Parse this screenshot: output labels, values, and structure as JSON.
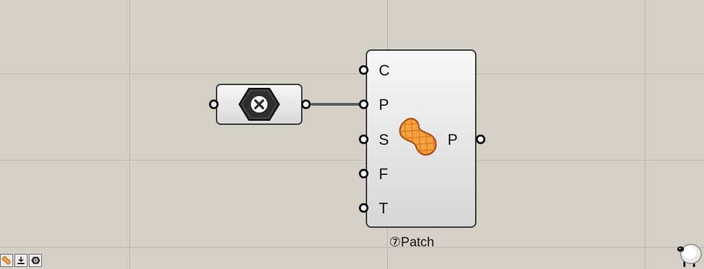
{
  "canvas": {
    "background": "#d4d0c8",
    "grid_color": "#bdb9b1"
  },
  "param_node": {
    "icon": "hexagon-close-icon"
  },
  "component": {
    "inputs": [
      "C",
      "P",
      "S",
      "F",
      "T"
    ],
    "output": "P",
    "icon": "patch-surface-icon",
    "caption": "⑦Patch"
  },
  "toolbar": {
    "icons": [
      "patch-icon",
      "download-icon",
      "hex-close-icon"
    ]
  },
  "navigator": {
    "icon": "sheep-icon"
  }
}
